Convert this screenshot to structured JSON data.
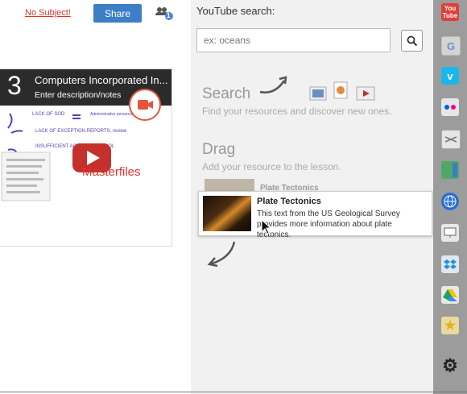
{
  "header": {
    "no_subject": "No Subject!",
    "share_label": "Share",
    "people_badge": "1"
  },
  "card": {
    "number": "3",
    "title": "Computers Incorporated In...",
    "description": "Enter description/notes",
    "thumb_lines": [
      "LACK OF SOD",
      "Administrative personnel",
      "LACK OF EXCEPTION REPORTS, review",
      "INSUFFICIENT ACCESS CONTROL"
    ],
    "watermark": "Masterfiles"
  },
  "search": {
    "title": "YouTube search:",
    "placeholder": "ex: oceans"
  },
  "hints": {
    "search_title": "Search",
    "search_sub": "Find your resources and discover new ones.",
    "drag_title": "Drag",
    "drag_sub": "Add your resource to the lesson."
  },
  "resource": {
    "title": "Plate Tectonics",
    "description": "This text from the US Geological Survey provides more information about plate tectonics."
  },
  "sidebar_icons": [
    "youtube-icon",
    "google-icon",
    "vimeo-icon",
    "flickr-icon",
    "scribd-icon",
    "docs-icon",
    "globe-icon",
    "monitor-icon",
    "dropbox-icon",
    "drive-icon",
    "star-icon",
    "gear-icon"
  ]
}
